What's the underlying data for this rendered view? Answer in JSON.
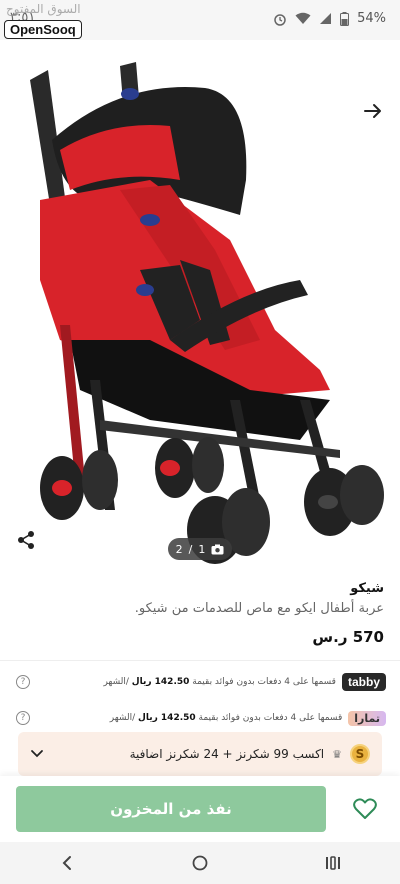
{
  "status_bar": {
    "left_text": "٣:٥١",
    "battery": "54%",
    "icons": [
      "alarm-icon",
      "wifi-icon",
      "signal-icon",
      "battery-icon"
    ]
  },
  "brand": {
    "watermark_ar": "السوق المفتوح",
    "logo": "OpenSooq"
  },
  "gallery": {
    "indicator_current": "1",
    "indicator_total": "2",
    "indicator_sep": "/"
  },
  "product": {
    "brand_name": "شيكو",
    "description": "عربة أطفال ايكو مع ماص للصدمات من شيكو.",
    "price": "570 ر.س"
  },
  "installments": [
    {
      "provider": "tabby",
      "text_before": "قسمها على 4 دفعات بدون فوائد بقيمة",
      "amount": "142.50 ريال",
      "text_after": "/الشهر"
    },
    {
      "provider": "تمارا",
      "text_before": "قسمها على 4 دفعات بدون فوائد بقيمة",
      "amount": "142.50 ريال",
      "text_after": "/الشهر"
    }
  ],
  "points": {
    "text": "اكسب 99 شكرنز + 24 شكرنز اضافية",
    "coin_letter": "S"
  },
  "actions": {
    "out_of_stock_label": "نفذ من المخزون"
  },
  "colors": {
    "accent_green": "#8ec99d",
    "favorite_green": "#2e8b57",
    "stroller_red": "#d8232a"
  }
}
